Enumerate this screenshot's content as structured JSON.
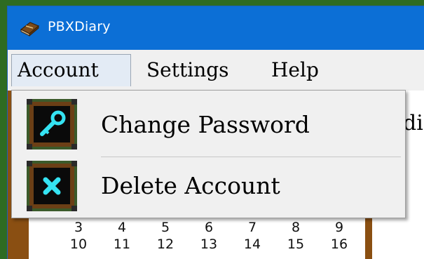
{
  "app": {
    "title": "PBXDiary",
    "icon": "diary-book-icon"
  },
  "menubar": {
    "items": [
      {
        "label": "Account",
        "active": true
      },
      {
        "label": "Settings",
        "active": false
      },
      {
        "label": "Help",
        "active": false
      }
    ]
  },
  "account_menu": {
    "items": [
      {
        "label": "Change Password",
        "icon": "key-icon"
      },
      {
        "label": "Delete Account",
        "icon": "delete-x-icon"
      }
    ]
  },
  "background": {
    "peek_text": "di",
    "calendar_rows": [
      [
        "3",
        "4",
        "5",
        "6",
        "7",
        "8",
        "9"
      ],
      [
        "10",
        "11",
        "12",
        "13",
        "14",
        "15",
        "16"
      ]
    ]
  },
  "colors": {
    "titlebar": "#0c6fd6",
    "icon_accent": "#35e3f2",
    "frame_green": "#3b5a2a",
    "frame_brown": "#6b3f16",
    "client_brown": "#8a4f12"
  }
}
